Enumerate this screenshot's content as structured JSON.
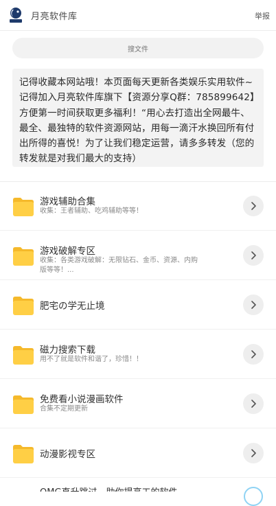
{
  "header": {
    "title": "月亮软件库",
    "report_label": "举报"
  },
  "search": {
    "placeholder": "搜文件"
  },
  "notice": {
    "text": "记得收藏本网站哦！本页面每天更新各类娱乐实用软件~记得加入月亮软件库旗下【资源分享Q群：785899642】方便第一时间获取更多福利！“用心去打造出全网最牛、最全、最独特的软件资源网站，用每一滴汗水换回所有付出所得的喜悦！为了让我们稳定运营，请多多转发（您的转发就是对我们最大的支持）"
  },
  "items": [
    {
      "title": "游戏辅助合集",
      "desc": "收集：王者辅助、吃鸡辅助等等！"
    },
    {
      "title": "游戏破解专区",
      "desc": "收集：各类游戏破解：无限钻石、金币、资源、内购版等等！..."
    },
    {
      "title": "肥宅の学无止境",
      "desc": ""
    },
    {
      "title": "磁力搜索下载",
      "desc": "用不了就是软件和谐了，珍惜！！"
    },
    {
      "title": "免费看小说漫画软件",
      "desc": "合集不定期更新"
    },
    {
      "title": "动漫影视专区",
      "desc": ""
    }
  ],
  "partial_item": {
    "title": "OMG直升跳过、助你提高工的软件"
  },
  "colors": {
    "folder": "#ffcf45",
    "folder_tab": "#f5b92b",
    "arrow_bg": "#eeeeee"
  },
  "icons": {
    "logo": "moon-logo-icon",
    "folder": "folder-icon",
    "arrow": "chevron-right-icon"
  }
}
